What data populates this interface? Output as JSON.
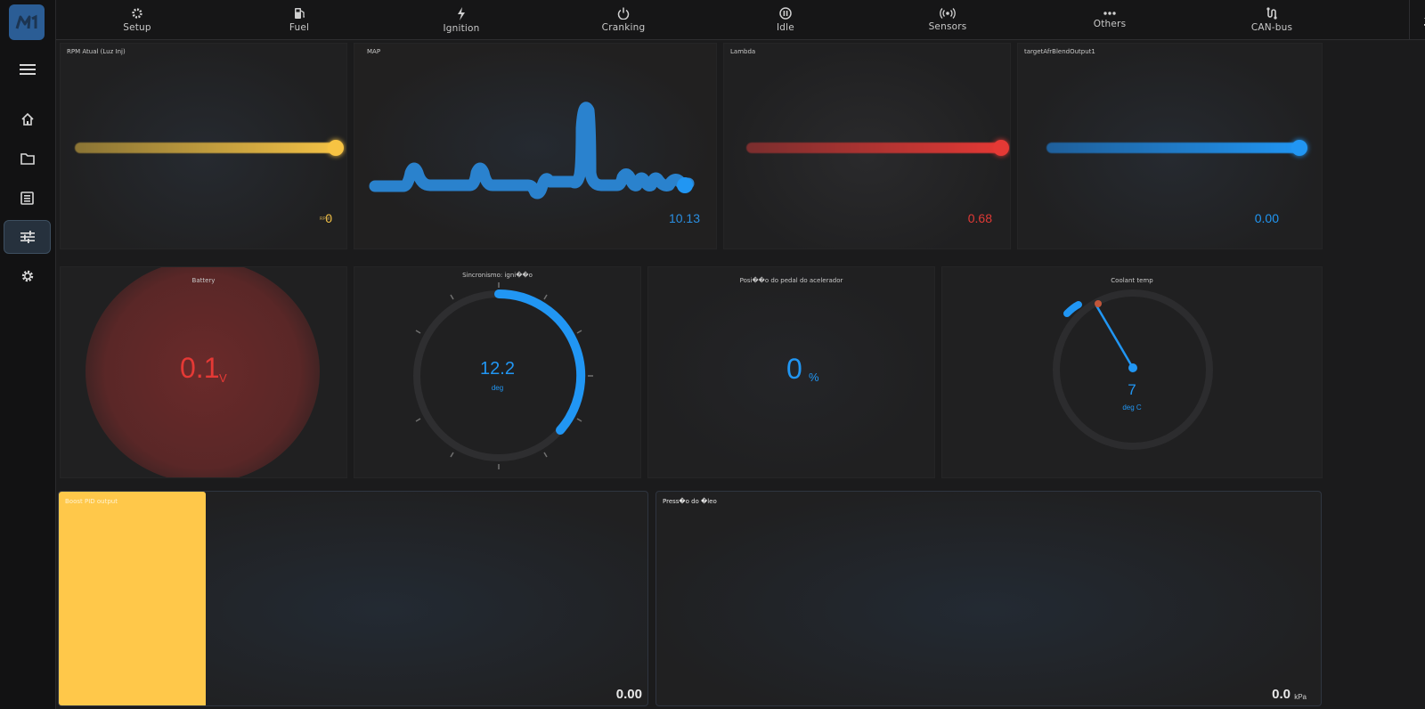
{
  "colors": {
    "accent_blue": "#2196f3",
    "accent_yellow": "#f7c343",
    "accent_red": "#e53935",
    "sidebar_bg": "#121213"
  },
  "sidebar": {
    "logo_text": "M",
    "items": [
      {
        "name": "menu",
        "icon": "hamburger-icon"
      },
      {
        "name": "home",
        "icon": "home-icon"
      },
      {
        "name": "folder",
        "icon": "folder-icon"
      },
      {
        "name": "dashboard",
        "icon": "list-box-icon"
      },
      {
        "name": "tune",
        "icon": "sliders-icon",
        "active": true
      },
      {
        "name": "settings",
        "icon": "gear-icon"
      }
    ]
  },
  "tabs": [
    {
      "label": "Setup",
      "icon": "gear-icon"
    },
    {
      "label": "Fuel",
      "icon": "fuel-pump-icon"
    },
    {
      "label": "Ignition",
      "icon": "lightning-icon"
    },
    {
      "label": "Cranking",
      "icon": "power-icon"
    },
    {
      "label": "Idle",
      "icon": "pause-circle-icon"
    },
    {
      "label": "Sensors",
      "icon": "broadcast-icon"
    },
    {
      "label": "Others",
      "icon": "dots-icon"
    },
    {
      "label": "CAN-bus",
      "icon": "can-bus-icon"
    }
  ],
  "toolbar": {
    "upload_icon": "upload-icon",
    "download_icon": "download-icon"
  },
  "gauges": {
    "rpm": {
      "title": "RPM Atual (Luz Inj)",
      "value": "0",
      "unit": "RPM",
      "level": 1.0
    },
    "map": {
      "title": "MAP",
      "value": "10.13"
    },
    "lambda": {
      "title": "Lambda",
      "value": "0.68",
      "level": 1.0
    },
    "target_afr": {
      "title": "targetAfrBlendOutput1",
      "value": "0.00",
      "level": 1.0
    },
    "battery": {
      "title": "Battery",
      "value": "0.1",
      "unit": "V"
    },
    "ignition": {
      "title": "Sincronismo: igni��o",
      "value": "12.2",
      "unit": "deg",
      "fraction": 0.4
    },
    "pedal": {
      "title": "Posi��o do pedal do acelerador",
      "value": "0",
      "unit": "%"
    },
    "coolant": {
      "title": "Coolant temp",
      "value": "7",
      "unit": "deg C"
    },
    "boost_pid": {
      "title": "Boost PID output",
      "value": "0.00"
    },
    "oil": {
      "title": "Press�o do �leo",
      "value": "0.0",
      "unit": "kPa"
    }
  }
}
